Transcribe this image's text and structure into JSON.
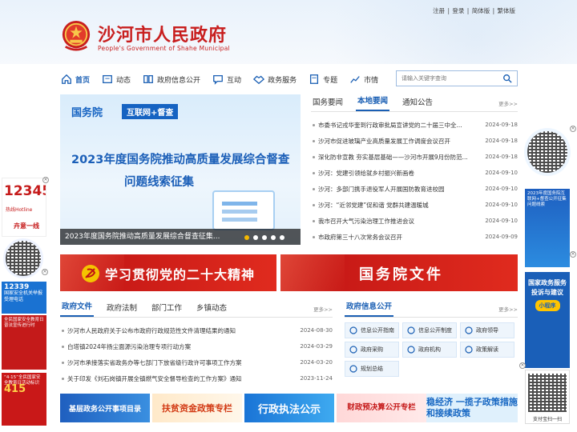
{
  "toplinks": [
    "注册",
    "登录",
    "简体版",
    "繁体版"
  ],
  "site": {
    "title": "沙河市人民政府",
    "subtitle": "People's Government of Shahe Municipal"
  },
  "nav": [
    "首页",
    "动态",
    "政府信息公开",
    "互动",
    "政务服务",
    "专题",
    "市情"
  ],
  "search": {
    "placeholder": "请输入关键字查询"
  },
  "banner": {
    "tag1": "国务院",
    "tag2": "互联网+督查",
    "line1": "2023年度国务院推动高质量发展综合督查",
    "line2": "问题线索征集",
    "caption": "2023年度国务院推动高质量发展综合督查征集..."
  },
  "news": {
    "tabs": [
      "国务要闻",
      "本地要闻",
      "通知公告"
    ],
    "more": "更多>>",
    "items": [
      {
        "title": "市委书记戎华奎到行政审批局宣讲党的二十届三中全...",
        "date": "2024-09-18"
      },
      {
        "title": "沙河市促进玻璃产业高质量发展工作调度会议召开",
        "date": "2024-09-18"
      },
      {
        "title": "深化防非宣教 夯实基层基础——沙河市开展9月份防范...",
        "date": "2024-09-18"
      },
      {
        "title": "沙河：党建引领给就乡村振兴新画卷",
        "date": "2024-09-10"
      },
      {
        "title": "沙河：多部门携手退役军人开展国防教育进校园",
        "date": "2024-09-10"
      },
      {
        "title": "沙河：“近邻党建”促和谐 党群共建温暖城",
        "date": "2024-09-10"
      },
      {
        "title": "我市召开大气污染治理工作推进会议",
        "date": "2024-09-10"
      },
      {
        "title": "市政府第三十八次常务会议召开",
        "date": "2024-09-09"
      }
    ]
  },
  "red_banners": [
    "学习贯彻党的二十大精神",
    "国务院文件"
  ],
  "docs": {
    "tabs": [
      "政府文件",
      "政府法制",
      "部门工作",
      "乡镇动态"
    ],
    "more": "更多>>",
    "items": [
      {
        "title": "沙河市人民政府关于公布市政府行政规范性文件清理结果的通知",
        "date": "2024-08-30"
      },
      {
        "title": "白塔镇2024年扬尘面源污染治理专项行动方案",
        "date": "2024-03-29"
      },
      {
        "title": "沙河市承接落实省政务办等七部门下放省级行政许可事项工作方案",
        "date": "2024-03-20"
      },
      {
        "title": "关于印发《刘石岗镇开展全镇燃气安全督导检查的工作方案》通知",
        "date": "2023-11-24"
      }
    ]
  },
  "info": {
    "title": "政府信息公开",
    "more": "更多>>",
    "buttons": [
      "信息公开指南",
      "信息公开制度",
      "政府领导",
      "政府采购",
      "政府机构",
      "政策解读",
      "规划总结"
    ]
  },
  "bottom": [
    "基层政务公开事项目录",
    "扶贫资金政策专栏",
    "行政执法公示",
    "财政预决算公开专栏",
    "稳经济 一揽子政策措施 和接续政策"
  ],
  "ads_left": {
    "hotline_big": "12345",
    "hotline_small": "热线Hotline",
    "hotline_tag": "卉意一线",
    "police_num": "12339",
    "police_text": "国家安全机关举报受理电话",
    "safety_text": "全民国家安全教育日普法宣传进行时",
    "edu_top": "“4·15”全民国家安全教育日活动标识",
    "edu_num": "415"
  },
  "ads_right": {
    "r1_text": "2023年度国务院互联网+督查公开征集问题线索",
    "r2_line1": "国家政务服务",
    "r2_line2": "投诉与建议",
    "r2_pill": "小程序",
    "r3_text": "支付宝扫一扫"
  },
  "colors": {
    "brand_red": "#c81e1e",
    "brand_blue": "#1a5fb4"
  }
}
